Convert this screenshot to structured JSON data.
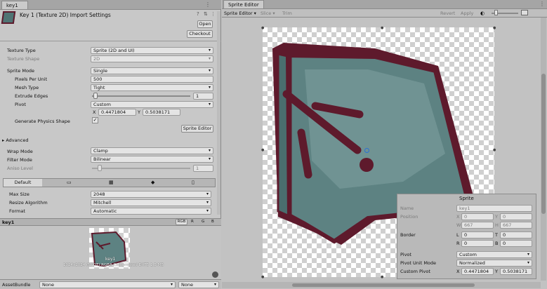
{
  "inspector": {
    "tab": "key1",
    "title": "Key 1 (Texture 2D) Import Settings",
    "open": "Open",
    "checkout": "Checkout",
    "texture_type_label": "Texture Type",
    "texture_type": "Sprite (2D and UI)",
    "texture_shape_label": "Texture Shape",
    "texture_shape": "2D",
    "sprite_mode_label": "Sprite Mode",
    "sprite_mode": "Single",
    "ppu_label": "Pixels Per Unit",
    "ppu": "500",
    "mesh_type_label": "Mesh Type",
    "mesh_type": "Tight",
    "extrude_label": "Extrude Edges",
    "extrude": "1",
    "pivot_label": "Pivot",
    "pivot": "Custom",
    "x_label": "X",
    "pivot_x": "0.4471804",
    "y_label": "Y",
    "pivot_y": "0.5038171",
    "physics_label": "Generate Physics Shape",
    "sprite_editor_btn": "Sprite Editor",
    "advanced": "Advanced",
    "wrap_label": "Wrap Mode",
    "wrap": "Clamp",
    "filter_label": "Filter Mode",
    "filter": "Bilinear",
    "aniso_label": "Aniso Level",
    "aniso": "1",
    "platform_default": "Default",
    "max_size_label": "Max Size",
    "max_size": "2048",
    "resize_label": "Resize Algorithm",
    "resize": "Mitchell",
    "format_label": "Format",
    "format": "Automatic"
  },
  "preview": {
    "title": "key1",
    "rgb": "RGB",
    "r": "R",
    "g": "G",
    "b": "B",
    "sprite_name": "key1",
    "info": "1024x1024 (NPOT) RGBA Compressed DXT5 1.3 MB"
  },
  "assetbundle": {
    "label": "AssetBundle",
    "value1": "None",
    "value2": "None"
  },
  "sprite_editor": {
    "tab": "Sprite Editor",
    "menu_sprite_editor": "Sprite Editor",
    "menu_slice": "Slice",
    "menu_trim": "Trim",
    "revert": "Revert",
    "apply": "Apply",
    "panel": {
      "title": "Sprite",
      "name_label": "Name",
      "name": "key1",
      "position_label": "Position",
      "pos_x": "0",
      "pos_y": "0",
      "pos_w": "667",
      "pos_h": "667",
      "border_label": "Border",
      "border_l": "0",
      "border_t": "0",
      "border_r": "0",
      "border_b": "0",
      "pivot_label": "Pivot",
      "pivot": "Custom",
      "pivot_unit_label": "Pivot Unit Mode",
      "pivot_unit": "Normalized",
      "custom_pivot_label": "Custom Pivot",
      "cp_x": "0.4471804",
      "cp_y": "0.5038171",
      "x": "X",
      "y": "Y",
      "w": "W",
      "h": "H",
      "l": "L",
      "t": "T",
      "r": "R",
      "b": "B"
    }
  },
  "colors": {
    "outline": "#5e1a2c",
    "key_fill": "#5d8282",
    "key_light": "#7fa2a2"
  }
}
